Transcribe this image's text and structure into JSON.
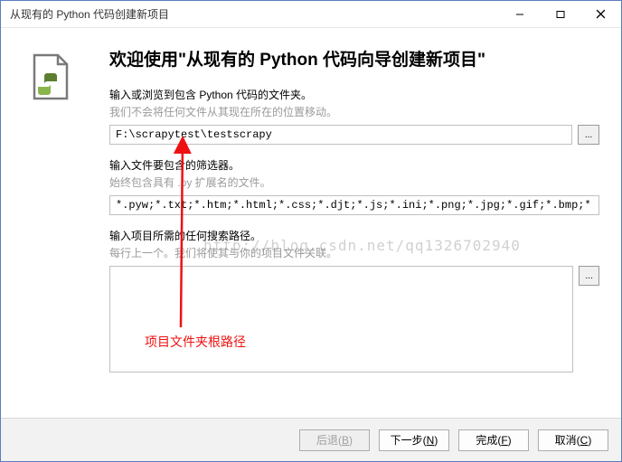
{
  "window": {
    "title": "从现有的 Python 代码创建新项目"
  },
  "heading": "欢迎使用\"从现有的 Python 代码向导创建新项目\"",
  "section1": {
    "label": "输入或浏览到包含 Python 代码的文件夹。",
    "sub": "我们不会将任何文件从其现在所在的位置移动。",
    "value": "F:\\scrapytest\\testscrapy"
  },
  "section2": {
    "label": "输入文件要包含的筛选器。",
    "sub": "始终包含具有 .py 扩展名的文件。",
    "value": "*.pyw;*.txt;*.htm;*.html;*.css;*.djt;*.js;*.ini;*.png;*.jpg;*.gif;*.bmp;*.ico;*.sv"
  },
  "section3": {
    "label": "输入项目所需的任何搜索路径。",
    "sub": "每行上一个。我们将使其与你的项目文件关联。",
    "value": ""
  },
  "buttons": {
    "browse": "...",
    "back": "后退(B)",
    "next": "下一步(N)",
    "finish": "完成(F)",
    "cancel": "取消(C)"
  },
  "annotation": {
    "root_path": "项目文件夹根路径",
    "watermark": "http://blog.csdn.net/qq1326702940"
  }
}
